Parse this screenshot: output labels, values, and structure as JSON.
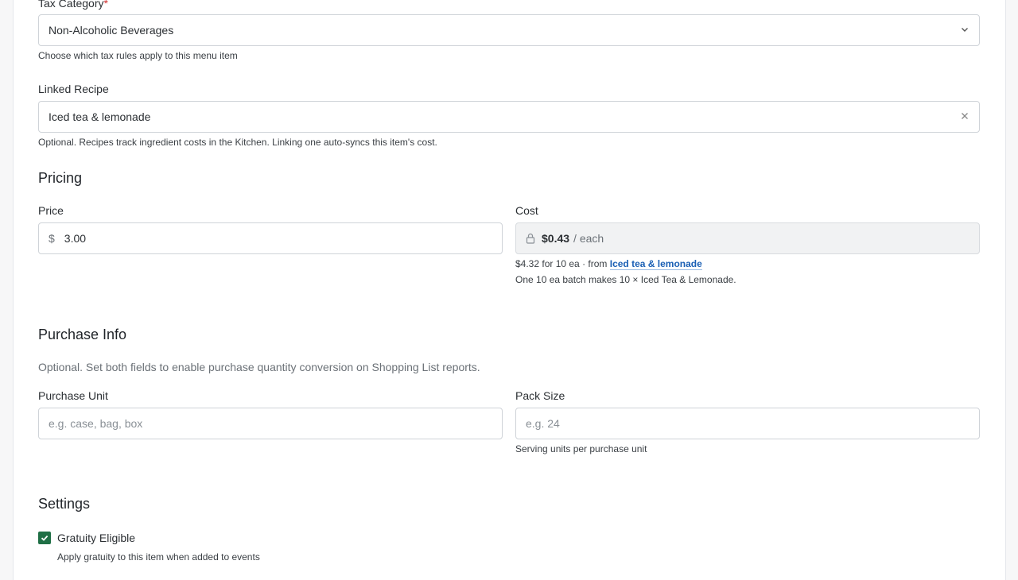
{
  "tax_category": {
    "label": "Tax Category",
    "required_mark": "*",
    "value": "Non-Alcoholic Beverages",
    "help": "Choose which tax rules apply to this menu item"
  },
  "linked_recipe": {
    "label": "Linked Recipe",
    "value": "Iced tea & lemonade",
    "help": "Optional. Recipes track ingredient costs in the Kitchen. Linking one auto-syncs this item's cost."
  },
  "pricing": {
    "title": "Pricing",
    "price_label": "Price",
    "currency_symbol": "$",
    "price_value": "3.00",
    "cost_label": "Cost",
    "cost_value": "$0.43",
    "cost_unit": "/ each",
    "cost_detail_prefix": "$4.32 for 10 ea · from",
    "cost_detail_link": "Iced tea & lemonade",
    "batch_note": "One 10 ea batch makes 10 × Iced Tea & Lemonade."
  },
  "purchase_info": {
    "title": "Purchase Info",
    "description": "Optional. Set both fields to enable purchase quantity conversion on Shopping List reports.",
    "unit_label": "Purchase Unit",
    "unit_placeholder": "e.g. case, bag, box",
    "pack_label": "Pack Size",
    "pack_placeholder": "e.g. 24",
    "pack_help": "Serving units per purchase unit"
  },
  "settings": {
    "title": "Settings",
    "gratuity_label": "Gratuity Eligible",
    "gratuity_checked": true,
    "gratuity_help": "Apply gratuity to this item when added to events"
  },
  "colors": {
    "accent_green": "#1f6f45",
    "link_blue": "#1a5fb4",
    "required_red": "#d32f2f"
  }
}
